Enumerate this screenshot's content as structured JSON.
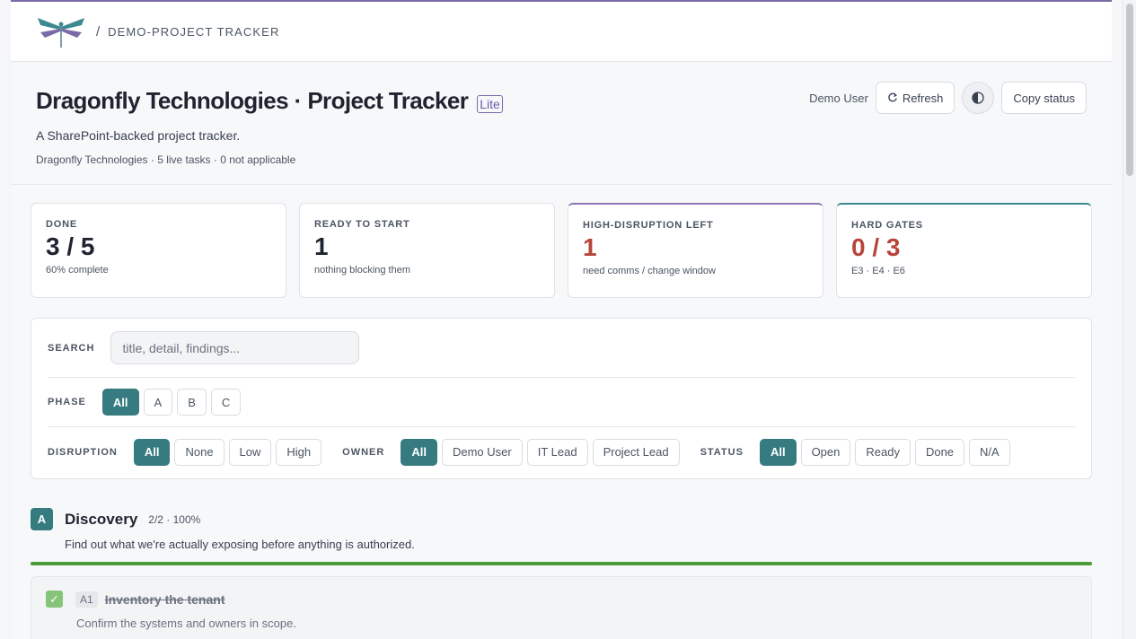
{
  "topbar": {
    "breadcrumb": "DEMO-PROJECT TRACKER",
    "separator": "/"
  },
  "header": {
    "title": "Dragonfly Technologies · Project Tracker",
    "badge": "Lite",
    "subtitle": "A SharePoint-backed project tracker.",
    "meta": "Dragonfly Technologies · 5 live tasks · 0 not applicable",
    "user": "Demo User",
    "refresh_label": "Refresh",
    "copy_label": "Copy status",
    "theme_icon": "contrast-icon"
  },
  "cards": [
    {
      "label": "DONE",
      "value": "3 / 5",
      "sub": "60% complete",
      "progress_fraction": 0.6
    },
    {
      "label": "READY TO START",
      "value": "1",
      "sub": "nothing blocking them"
    },
    {
      "label": "HIGH-DISRUPTION LEFT",
      "value": "1",
      "sub": "need comms / change window"
    },
    {
      "label": "HARD GATES",
      "value": "0 / 3",
      "sub": "E3 · E4 · E6"
    }
  ],
  "filters": {
    "search_label": "SEARCH",
    "search_placeholder": "title, detail, findings...",
    "search_value": "",
    "phase_label": "PHASE",
    "phase_options": [
      "All",
      "A",
      "B",
      "C"
    ],
    "disruption_label": "DISRUPTION",
    "disruption_options": [
      "All",
      "None",
      "Low",
      "High"
    ],
    "owner_label": "OWNER",
    "owner_options": [
      "All",
      "Demo User",
      "IT Lead",
      "Project Lead"
    ],
    "status_label": "STATUS",
    "status_options": [
      "All",
      "Open",
      "Ready",
      "Done",
      "N/A"
    ],
    "selected": {
      "phase": "All",
      "disruption": "All",
      "owner": "All",
      "status": "All"
    }
  },
  "phase": {
    "badge": "A",
    "title": "Discovery",
    "count": "2/2 · 100%",
    "description": "Find out what we're actually exposing before anything is authorized.",
    "progress_percent": 100
  },
  "task": {
    "checked": true,
    "check_glyph": "✓",
    "id": "A1",
    "title": "Inventory the tenant",
    "description": "Confirm the systems and owners in scope."
  },
  "colors": {
    "accent_teal": "#357b80",
    "value_red": "#b8453c",
    "progress_green": "#4a9a3a",
    "brand_purple": "#7a6aa8"
  }
}
